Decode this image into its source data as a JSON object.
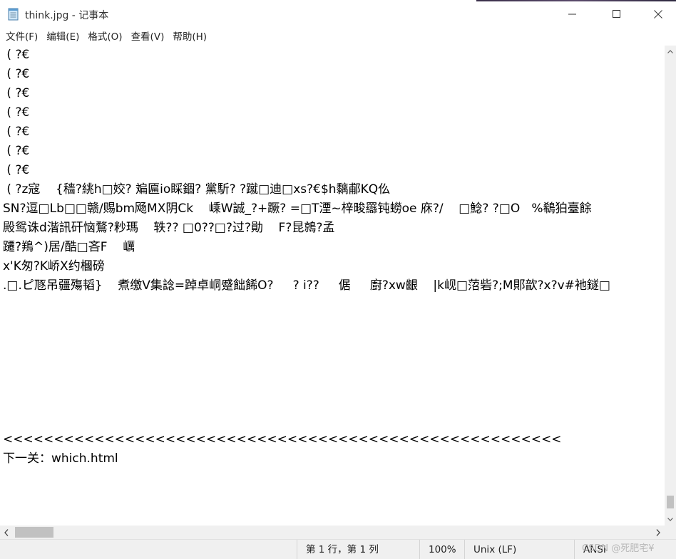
{
  "window": {
    "title": "think.jpg - 记事本",
    "icon": "notepad-icon",
    "controls": {
      "minimize": "minimize-icon",
      "maximize": "maximize-icon",
      "close": "close-icon"
    }
  },
  "menu": [
    {
      "label": "文件(F)"
    },
    {
      "label": "编辑(E)"
    },
    {
      "label": "格式(O)"
    },
    {
      "label": "查看(V)"
    },
    {
      "label": "帮助(H)"
    }
  ],
  "editor": {
    "lines": [
      " ( ?€",
      " ( ?€",
      " ( ?€",
      " ( ?€",
      " ( ?€",
      " ( ?€",
      " ( ?€",
      " ( ?z寇    {穑?絩h□姣? 斒匾io睬錮? 黨馸? ?蹴□迪□xs?€$h黐郙KQ仫",
      "SN?逗□Lb□□赣/赐bm飏MX阴Ck    嵊W誠_?+蹶? =□T湮~梓畯羉钝蟧oe 庥?/    □鯰? ?□O   %鵗狛臺餘",
      "殿鸳诛d湝訊矸恼鶩?粆瑪    轶?? □0??□?过?勛    F?昆鶁?孟",
      "躚?鴹^)居/酷□吝F    巁",
      "x'K匆?K峤X约槶磅",
      ".□.ピ豗吊疆殤韬}    煮缴V集諗=踔卓峒蹙飿餙O?     ? i??     倨     廚?xw齦    |k岘□菬砦?;M郥歆?x?v#衪鐩□",
      "",
      "",
      "",
      "",
      "",
      "",
      "",
      "<<<<<<<<<<<<<<<<<<<<<<<<<<<<<<<<<<<<<<<<<<<<<<<<<<<<<<<",
      "下一关：which.html"
    ]
  },
  "status": {
    "position": "第 1 行，第 1 列",
    "zoom": "100%",
    "line_ending": "Unix (LF)",
    "encoding": "ANSI"
  },
  "watermark": "CSDN @死肥宅¥"
}
